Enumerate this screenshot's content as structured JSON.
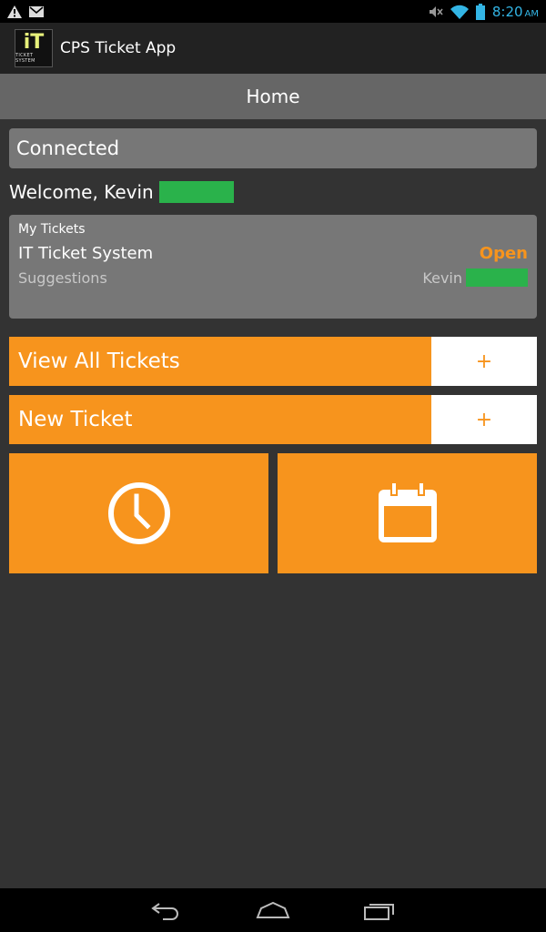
{
  "status_bar": {
    "icons_left": [
      "warning-icon",
      "gmail-icon"
    ],
    "icons_right": [
      "mute-icon",
      "wifi-icon",
      "battery-icon"
    ],
    "time": "8:20",
    "ampm": "AM"
  },
  "action_bar": {
    "logo_text": "iT",
    "logo_subtext": "TICKET SYSTEM",
    "title": "CPS Ticket App"
  },
  "header": {
    "title": "Home"
  },
  "connection": {
    "status": "Connected"
  },
  "welcome": {
    "text": "Welcome, Kevin"
  },
  "my_tickets": {
    "heading": "My Tickets",
    "items": [
      {
        "name": "IT Ticket System",
        "status": "Open",
        "category": "Suggestions",
        "owner": "Kevin"
      }
    ]
  },
  "buttons": {
    "view_all": {
      "label": "View All Tickets",
      "plus": "+"
    },
    "new_ticket": {
      "label": "New Ticket",
      "plus": "+"
    }
  },
  "tiles": [
    {
      "icon": "clock-icon"
    },
    {
      "icon": "calendar-icon"
    }
  ],
  "colors": {
    "accent": "#f7941d",
    "background": "#333333",
    "card": "#777777",
    "header": "#666666",
    "status_time": "#33b5e5",
    "redaction": "#2ab24b"
  },
  "nav_bar": {
    "icons": [
      "back-icon",
      "home-icon",
      "recent-apps-icon"
    ]
  }
}
